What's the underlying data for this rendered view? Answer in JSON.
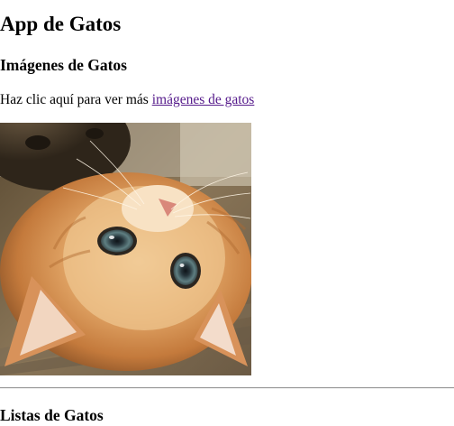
{
  "page": {
    "title": "App de Gatos"
  },
  "images_section": {
    "heading": "Imágenes de Gatos",
    "intro_text": "Haz clic aquí para ver más ",
    "link_text": "imágenes de gatos",
    "photo_subject": "kitten lying on its back"
  },
  "lists_section": {
    "heading": "Listas de Gatos"
  },
  "colors": {
    "visited_link": "#551a8b",
    "text": "#000000",
    "background": "#ffffff"
  }
}
